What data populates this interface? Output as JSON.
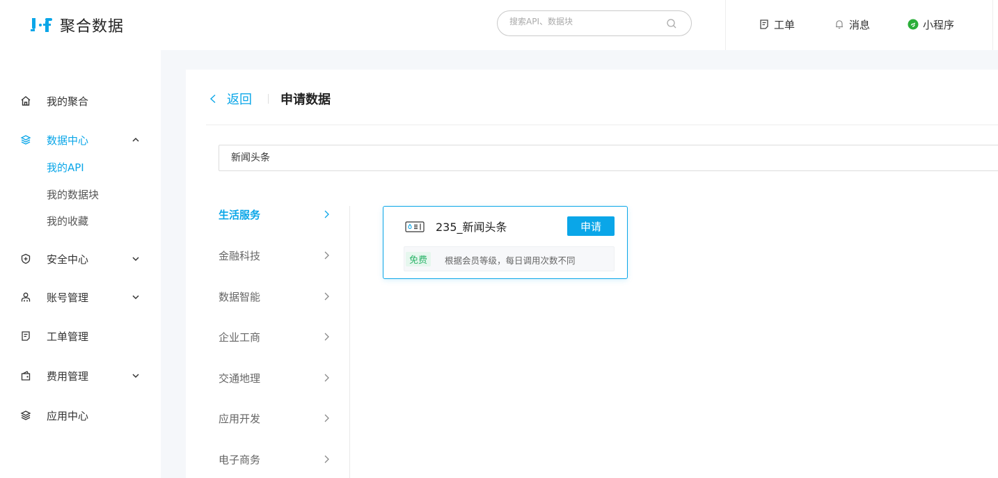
{
  "app": {
    "logo_text": "聚合数据",
    "brand_color": "#0aa6e8"
  },
  "header": {
    "search_placeholder": "搜索API、数据块",
    "ticket_label": "工单",
    "message_label": "消息",
    "miniprogram_label": "小程序"
  },
  "sidebar": {
    "items": [
      {
        "label": "我的聚合",
        "icon": "home-icon"
      },
      {
        "label": "数据中心",
        "icon": "layers-icon",
        "expanded": true,
        "active": true
      },
      {
        "label": "安全中心",
        "icon": "shield-icon"
      },
      {
        "label": "账号管理",
        "icon": "user-icon"
      },
      {
        "label": "工单管理",
        "icon": "ticket-icon"
      },
      {
        "label": "费用管理",
        "icon": "wallet-icon"
      },
      {
        "label": "应用中心",
        "icon": "layers-icon"
      }
    ],
    "data_center_sub": [
      {
        "label": "我的API",
        "active": true
      },
      {
        "label": "我的数据块"
      },
      {
        "label": "我的收藏"
      }
    ]
  },
  "main": {
    "back_label": "返回",
    "page_title": "申请数据",
    "keyword_value": "新闻头条",
    "categories": [
      {
        "label": "生活服务",
        "active": true
      },
      {
        "label": "金融科技"
      },
      {
        "label": "数据智能"
      },
      {
        "label": "企业工商"
      },
      {
        "label": "交通地理"
      },
      {
        "label": "应用开发"
      },
      {
        "label": "电子商务"
      }
    ],
    "card": {
      "title": "235_新闻头条",
      "apply_label": "申请",
      "badge": "免费",
      "description": "根据会员等级，每日调用次数不同"
    }
  }
}
